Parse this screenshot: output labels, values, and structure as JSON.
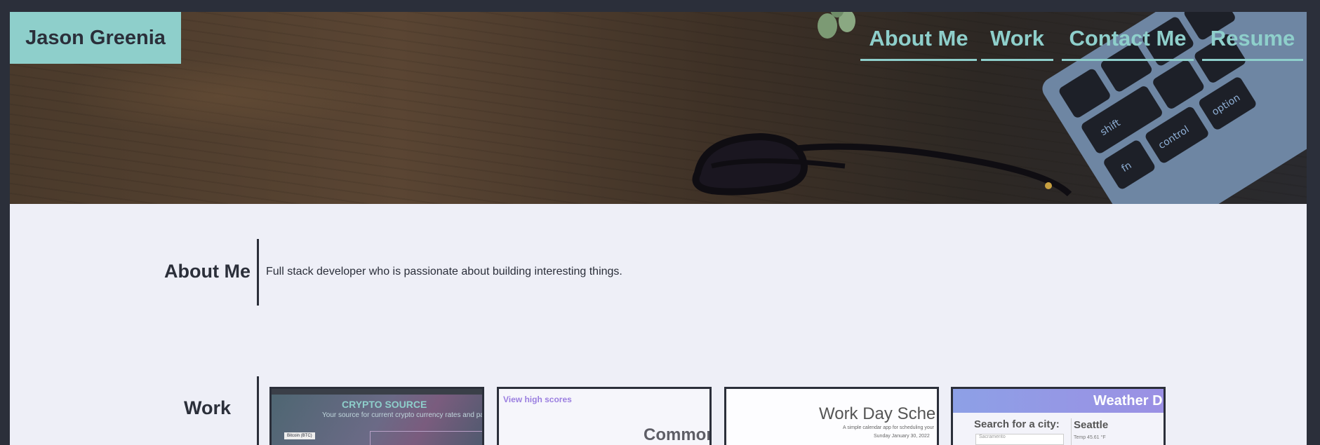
{
  "header": {
    "brand": "Jason Greenia",
    "nav": [
      {
        "label": "About Me"
      },
      {
        "label": "Work"
      },
      {
        "label": "Contact Me"
      },
      {
        "label": "Resume"
      }
    ]
  },
  "about": {
    "title": "About Me",
    "text": "Full stack developer who is passionate about building interesting things."
  },
  "work": {
    "title": "Work",
    "projects": [
      {
        "title": "CRYPTO SOURCE",
        "subtitle": "Your source for current crypto currency rates and pattern",
        "button": "Bitcoin (BTC)"
      },
      {
        "link": "View high scores",
        "title": "Commor"
      },
      {
        "title": "Work Day Sche",
        "subtitle": "A simple calendar app for scheduling your",
        "date": "Sunday January 30, 2022"
      },
      {
        "title": "Weather D",
        "search_label": "Search for a city:",
        "search_value": "Sacramento",
        "city": "Seattle",
        "temp": "Temp 45.61 °F"
      }
    ]
  },
  "colors": {
    "accent": "#8ecfcb",
    "dark": "#2b2f3a",
    "page": "#eeeff7"
  }
}
